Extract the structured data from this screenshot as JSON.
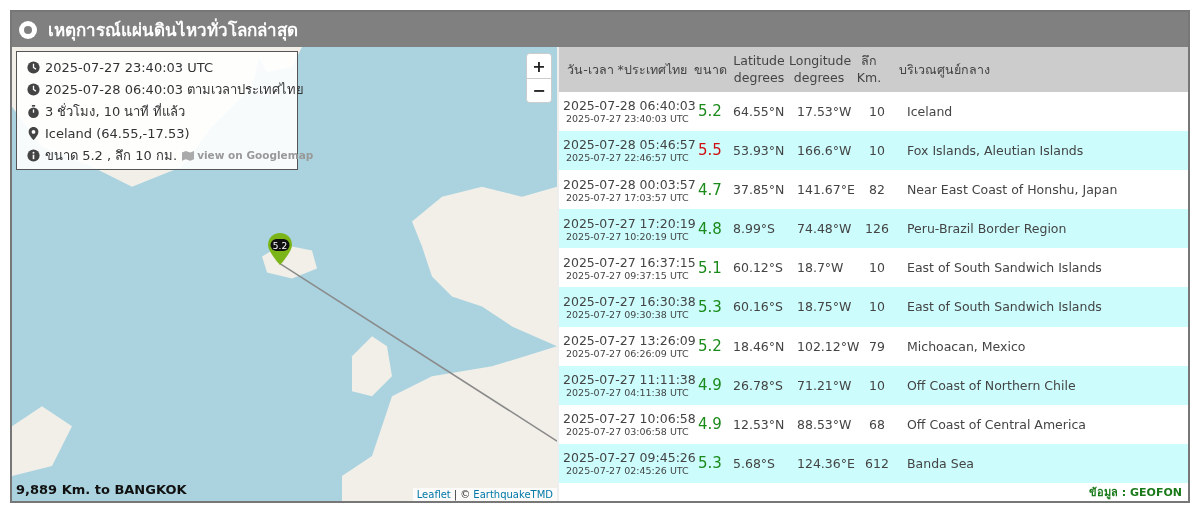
{
  "panel": {
    "title": "เหตุการณ์แผ่นดินไหวทั่วโลกล่าสุด"
  },
  "map": {
    "info_lines": [
      {
        "kind": "clock",
        "text": "2025-07-27 23:40:03 UTC"
      },
      {
        "kind": "clock",
        "text": "2025-07-28 06:40:03 ตามเวลาประเทศไทย"
      },
      {
        "kind": "stopwatch",
        "text": "3 ชั่วโมง, 10 นาที ที่แล้ว"
      },
      {
        "kind": "pin",
        "text": "Iceland (64.55,-17.53)"
      },
      {
        "kind": "info",
        "text": "ขนาด 5.2 , ลึก 10 กม.",
        "link": "view on Googlemap"
      }
    ],
    "zoom_in": "+",
    "zoom_out": "−",
    "marker_label": "5.2",
    "distance": "9,889 Km. to BANGKOK",
    "attribution": {
      "leaflet": "Leaflet",
      "separator": "| ©",
      "source": "EarthquakeTMD"
    }
  },
  "table": {
    "columns": [
      {
        "lines": [
          "วัน-เวลา *ประเทศไทย"
        ]
      },
      {
        "lines": [
          "ขนาด"
        ]
      },
      {
        "lines": [
          "Latitude",
          "degrees"
        ]
      },
      {
        "lines": [
          "Longitude",
          "degrees"
        ]
      },
      {
        "lines": [
          "ลึก",
          "Km."
        ]
      },
      {
        "lines": [
          "บริเวณศูนย์กลาง"
        ]
      }
    ],
    "rows": [
      {
        "local": "2025-07-28 06:40:03",
        "utc": "2025-07-27 23:40:03 UTC",
        "magnitude": "5.2",
        "color": "#1a8a1a",
        "latitude": "64.55°N",
        "longitude": "17.53°W",
        "depth": "10",
        "region": "Iceland"
      },
      {
        "local": "2025-07-28 05:46:57",
        "utc": "2025-07-27 22:46:57 UTC",
        "magnitude": "5.5",
        "color": "#d01010",
        "latitude": "53.93°N",
        "longitude": "166.6°W",
        "depth": "10",
        "region": "Fox Islands, Aleutian Islands"
      },
      {
        "local": "2025-07-28 00:03:57",
        "utc": "2025-07-27 17:03:57 UTC",
        "magnitude": "4.7",
        "color": "#1a8a1a",
        "latitude": "37.85°N",
        "longitude": "141.67°E",
        "depth": "82",
        "region": "Near East Coast of Honshu, Japan"
      },
      {
        "local": "2025-07-27 17:20:19",
        "utc": "2025-07-27 10:20:19 UTC",
        "magnitude": "4.8",
        "color": "#1a8a1a",
        "latitude": "8.99°S",
        "longitude": "74.48°W",
        "depth": "126",
        "region": "Peru-Brazil Border Region"
      },
      {
        "local": "2025-07-27 16:37:15",
        "utc": "2025-07-27 09:37:15 UTC",
        "magnitude": "5.1",
        "color": "#1a8a1a",
        "latitude": "60.12°S",
        "longitude": "18.7°W",
        "depth": "10",
        "region": "East of South Sandwich Islands"
      },
      {
        "local": "2025-07-27 16:30:38",
        "utc": "2025-07-27 09:30:38 UTC",
        "magnitude": "5.3",
        "color": "#1a8a1a",
        "latitude": "60.16°S",
        "longitude": "18.75°W",
        "depth": "10",
        "region": "East of South Sandwich Islands"
      },
      {
        "local": "2025-07-27 13:26:09",
        "utc": "2025-07-27 06:26:09 UTC",
        "magnitude": "5.2",
        "color": "#1a8a1a",
        "latitude": "18.46°N",
        "longitude": "102.12°W",
        "depth": "79",
        "region": "Michoacan, Mexico"
      },
      {
        "local": "2025-07-27 11:11:38",
        "utc": "2025-07-27 04:11:38 UTC",
        "magnitude": "4.9",
        "color": "#1a8a1a",
        "latitude": "26.78°S",
        "longitude": "71.21°W",
        "depth": "10",
        "region": "Off Coast of Northern Chile"
      },
      {
        "local": "2025-07-27 10:06:58",
        "utc": "2025-07-27 03:06:58 UTC",
        "magnitude": "4.9",
        "color": "#1a8a1a",
        "latitude": "12.53°N",
        "longitude": "88.53°W",
        "depth": "68",
        "region": "Off Coast of Central America"
      },
      {
        "local": "2025-07-27 09:45:26",
        "utc": "2025-07-27 02:45:26 UTC",
        "magnitude": "5.3",
        "color": "#1a8a1a",
        "latitude": "5.68°S",
        "longitude": "124.36°E",
        "depth": "612",
        "region": "Banda Sea"
      }
    ],
    "source": "ข้อมูล : GEOFON"
  }
}
